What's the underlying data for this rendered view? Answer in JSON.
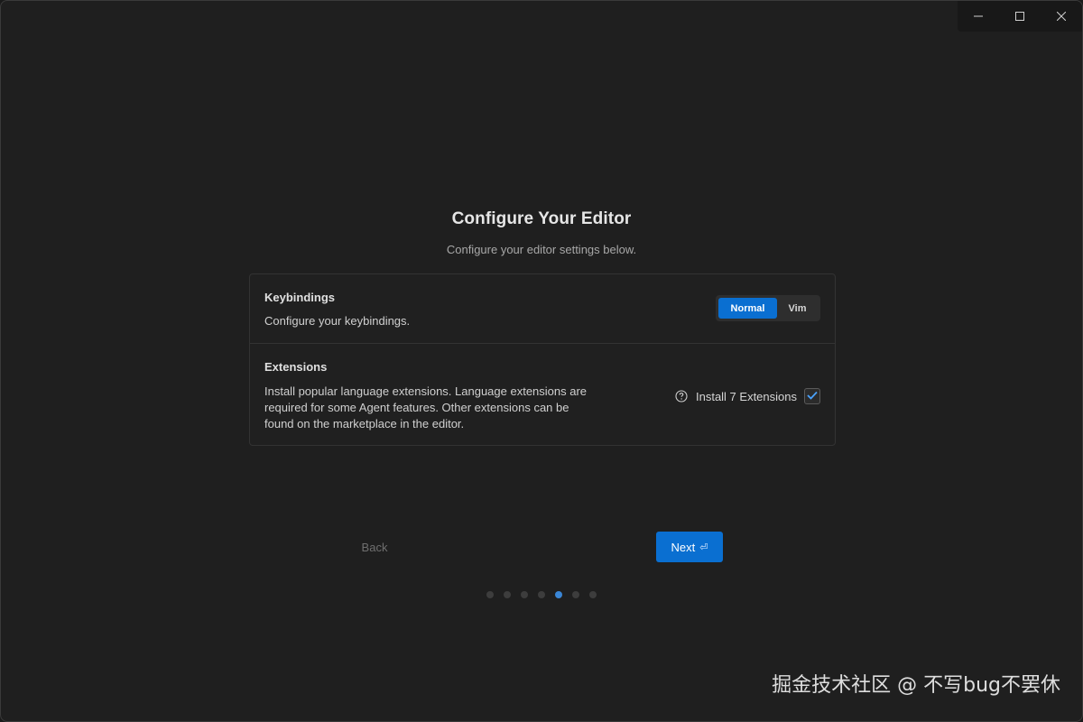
{
  "window": {
    "controls": [
      {
        "name": "minimize",
        "icon": "minimize-icon"
      },
      {
        "name": "maximize",
        "icon": "maximize-icon"
      },
      {
        "name": "close",
        "icon": "close-icon"
      }
    ]
  },
  "header": {
    "title": "Configure Your Editor",
    "subtitle": "Configure your editor settings below."
  },
  "keybindings": {
    "title": "Keybindings",
    "description": "Configure your keybindings.",
    "options": [
      "Normal",
      "Vim"
    ],
    "selected": "Normal"
  },
  "extensions": {
    "title": "Extensions",
    "description": "Install popular language extensions. Language extensions are required for some Agent features. Other extensions can be found on the marketplace in the editor.",
    "help_icon": "help-circle-icon",
    "install_label": "Install 7 Extensions",
    "install_checked": true
  },
  "footer": {
    "back_label": "Back",
    "next_label": "Next",
    "next_icon": "enter-key-icon",
    "steps_total": 7,
    "current_step": 5
  },
  "watermark": "掘金技术社区 @ 不写bug不罢休",
  "colors": {
    "accent": "#0a6fd1",
    "background": "#1f1f1f",
    "active_dot": "#3a86d6"
  }
}
